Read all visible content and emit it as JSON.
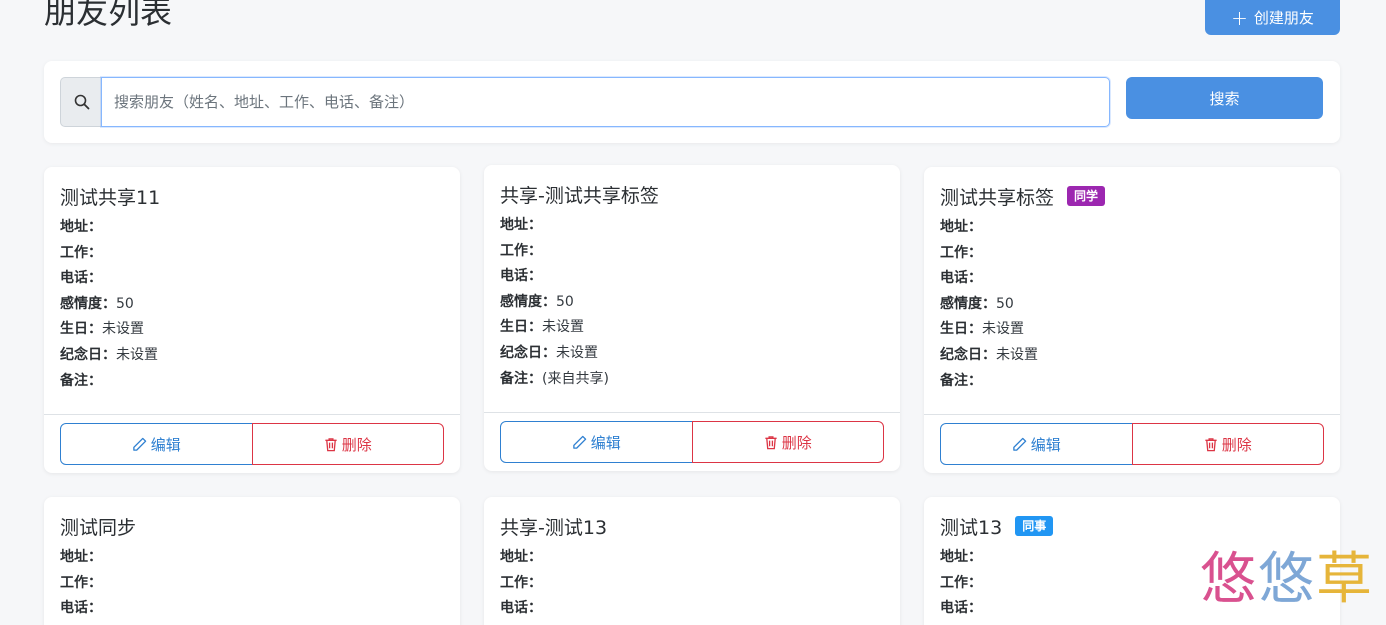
{
  "header": {
    "title": "朋友列表",
    "create_label": "创建朋友"
  },
  "search": {
    "placeholder": "搜索朋友（姓名、地址、工作、电话、备注）",
    "value": "",
    "button_label": "搜索"
  },
  "labels": {
    "address": "地址：",
    "job": "工作：",
    "phone": "电话：",
    "affinity": "感情度：",
    "birthday": "生日：",
    "anniversary": "纪念日：",
    "notes": "备注："
  },
  "actions": {
    "edit": "编辑",
    "delete": "删除"
  },
  "friends": [
    {
      "name": "测试共享11",
      "tag": "",
      "address": "",
      "job": "",
      "phone": "",
      "affinity": "50",
      "birthday": "未设置",
      "anniversary": "未设置",
      "notes": ""
    },
    {
      "name": "共享-测试共享标签",
      "tag": "",
      "address": "",
      "job": "",
      "phone": "",
      "affinity": "50",
      "birthday": "未设置",
      "anniversary": "未设置",
      "notes": "(来自共享)"
    },
    {
      "name": "测试共享标签",
      "tag": "同学",
      "tag_color": "#9c27b0",
      "address": "",
      "job": "",
      "phone": "",
      "affinity": "50",
      "birthday": "未设置",
      "anniversary": "未设置",
      "notes": ""
    },
    {
      "name": "测试同步",
      "tag": "",
      "address": "",
      "job": "",
      "phone": ""
    },
    {
      "name": "共享-测试13",
      "tag": "",
      "address": "",
      "job": "",
      "phone": ""
    },
    {
      "name": "测试13",
      "tag": "同事",
      "tag_color": "#2196f3",
      "address": "",
      "job": "",
      "phone": ""
    }
  ],
  "watermark": {
    "c1": "悠",
    "c2": "悠",
    "c3": "草"
  },
  "colors": {
    "primary": "#4a90e2",
    "danger": "#dc3545",
    "edit": "#2f80d1"
  }
}
